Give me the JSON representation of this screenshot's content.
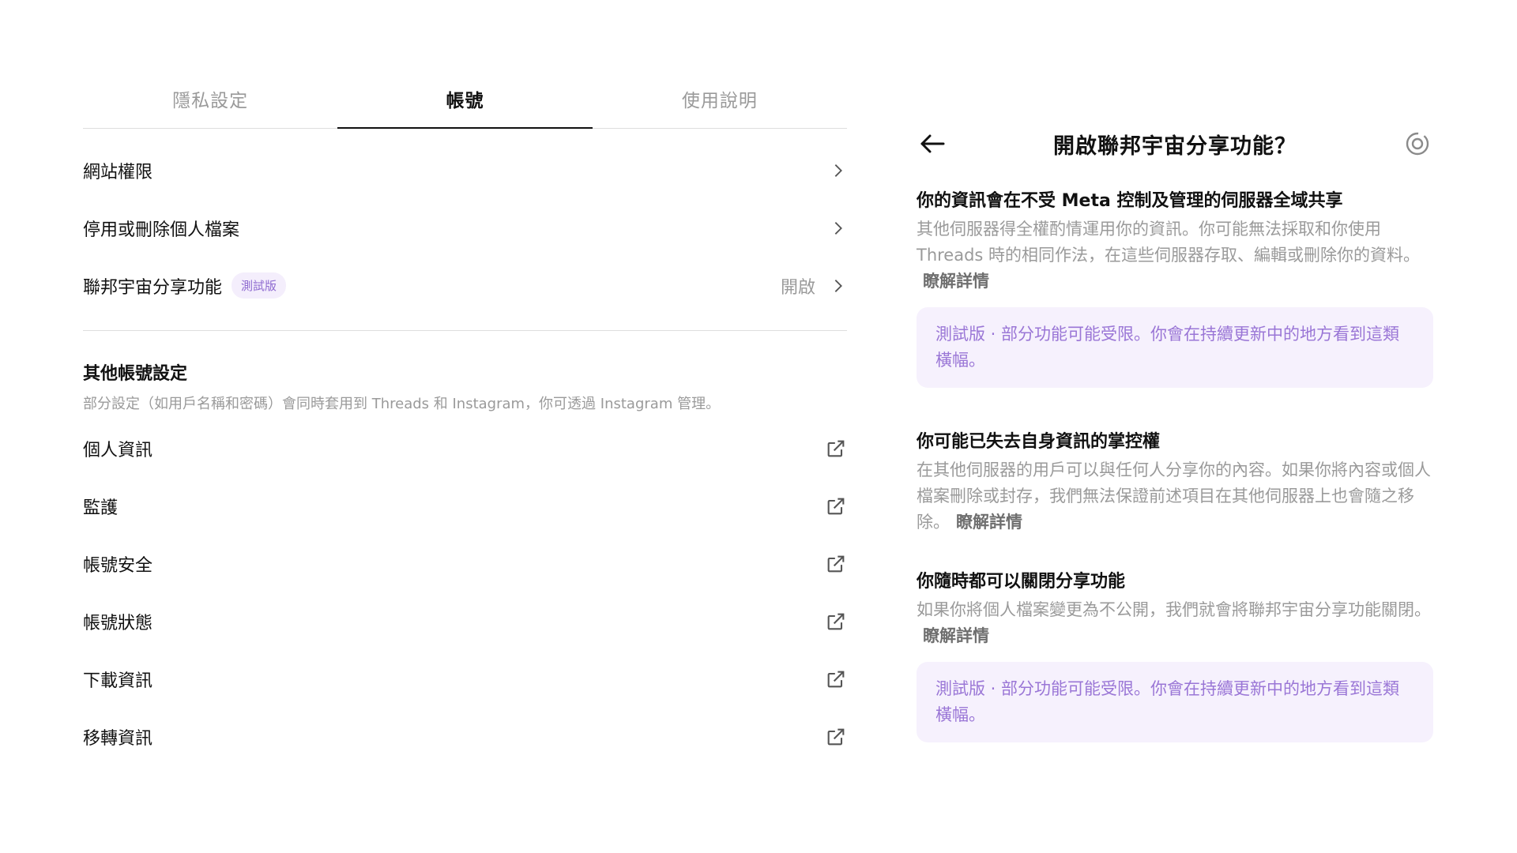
{
  "tabs": [
    {
      "label": "隱私設定"
    },
    {
      "label": "帳號"
    },
    {
      "label": "使用說明"
    }
  ],
  "account": {
    "rows": [
      {
        "label": "網站權限"
      },
      {
        "label": "停用或刪除個人檔案"
      },
      {
        "label": "聯邦宇宙分享功能",
        "badge": "測試版",
        "value": "開啟"
      }
    ],
    "other_title": "其他帳號設定",
    "other_subtitle": "部分設定（如用戶名稱和密碼）會同時套用到 Threads 和 Instagram，你可透過 Instagram 管理。",
    "external_rows": [
      {
        "label": "個人資訊"
      },
      {
        "label": "監護"
      },
      {
        "label": "帳號安全"
      },
      {
        "label": "帳號狀態"
      },
      {
        "label": "下載資訊"
      },
      {
        "label": "移轉資訊"
      }
    ]
  },
  "fediverse": {
    "title": "開啟聯邦宇宙分享功能？",
    "section1": {
      "title": "你的資訊會在不受 Meta 控制及管理的伺服器全域共享",
      "body": "其他伺服器得全權酌情運用你的資訊。你可能無法採取和你使用 Threads 時的相同作法，在這些伺服器存取、編輯或刪除你的資料。",
      "link": "瞭解詳情"
    },
    "beta_note_1": "測試版 · 部分功能可能受限。你會在持續更新中的地方看到這類橫幅。",
    "section2": {
      "title": "你可能已失去自身資訊的掌控權",
      "body": "在其他伺服器的用戶可以與任何人分享你的內容。如果你將內容或個人檔案刪除或封存，我們無法保證前述項目在其他伺服器上也會隨之移除。",
      "link": "瞭解詳情"
    },
    "section3": {
      "title": "你隨時都可以關閉分享功能",
      "body": "如果你將個人檔案變更為不公開，我們就會將聯邦宇宙分享功能關閉。",
      "link": "瞭解詳情"
    },
    "beta_note_2": "測試版 · 部分功能可能受限。你會在持續更新中的地方看到這類橫幅。"
  },
  "icons": {
    "chevron": "chevron-right-icon",
    "external": "external-link-icon",
    "back": "back-arrow-icon",
    "fediverse": "fediverse-icon"
  },
  "colors": {
    "accent_purple": "#9a76d6",
    "beta_bg": "#f6f1fd",
    "muted": "#9a9a9a"
  }
}
